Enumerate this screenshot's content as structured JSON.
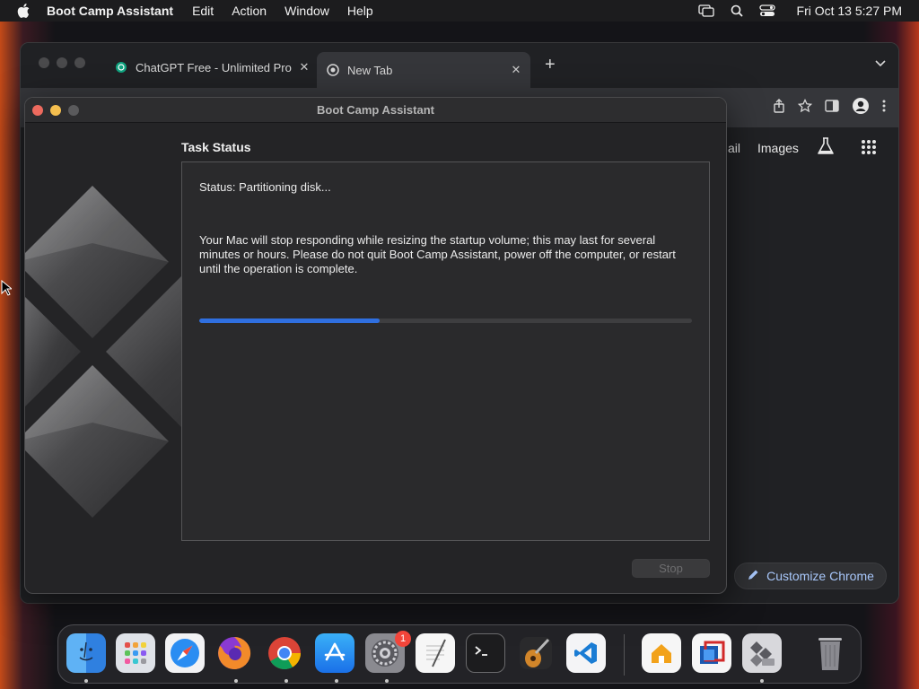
{
  "menubar": {
    "apple_icon": "apple-logo",
    "app_name": "Boot Camp Assistant",
    "menus": [
      "Edit",
      "Action",
      "Window",
      "Help"
    ],
    "status_icons": [
      "screen-mirroring-icon",
      "spotlight-search-icon",
      "control-center-icon"
    ],
    "clock": "Fri Oct 13  5:27 PM"
  },
  "chrome": {
    "tabs": [
      {
        "title": "ChatGPT Free - Unlimited Pro",
        "favicon": "chatgpt-icon"
      },
      {
        "title": "New Tab",
        "favicon": "chrome-icon"
      }
    ],
    "new_tab_label": "+",
    "header_links": {
      "gmail": "ail",
      "images": "Images"
    },
    "customize_label": "Customize Chrome"
  },
  "bootcamp": {
    "window_title": "Boot Camp Assistant",
    "heading": "Task Status",
    "status": "Status: Partitioning disk...",
    "message": "Your Mac will stop responding while resizing the startup volume; this may last for several minutes or hours. Please do not quit Boot Camp Assistant, power off the computer, or restart until the operation is complete.",
    "progress_fraction": 0.366,
    "stop_label": "Stop",
    "colors": {
      "progress": "#2f6fe0",
      "close": "#ed6a5e",
      "minimize": "#f5bf4f",
      "zoom": "#5a5a5c"
    }
  },
  "dock": {
    "apps": [
      {
        "name": "finder-icon",
        "running": true
      },
      {
        "name": "launchpad-icon",
        "running": false
      },
      {
        "name": "safari-icon",
        "running": false
      },
      {
        "name": "firefox-icon",
        "running": true
      },
      {
        "name": "chrome-icon",
        "running": true
      },
      {
        "name": "app-store-icon",
        "running": true
      },
      {
        "name": "system-settings-icon",
        "running": true
      },
      {
        "name": "textedit-icon",
        "running": false
      },
      {
        "name": "terminal-icon",
        "running": false
      },
      {
        "name": "garageband-icon",
        "running": false
      },
      {
        "name": "vscode-icon",
        "running": false
      },
      {
        "name": "home-icon",
        "running": false
      },
      {
        "name": "parallels-icon",
        "running": false
      },
      {
        "name": "boot-camp-icon",
        "running": true
      },
      {
        "name": "trash-icon",
        "running": false
      }
    ],
    "settings_badge": "1"
  }
}
